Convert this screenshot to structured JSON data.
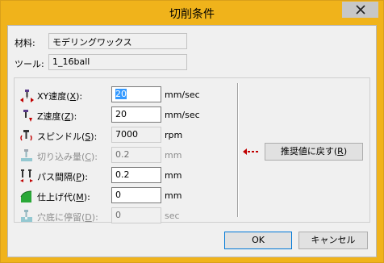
{
  "window": {
    "title": "切削条件",
    "close_glyph": "×"
  },
  "material": {
    "label": "材料:",
    "value": "モデリングワックス"
  },
  "tool": {
    "label": "ツール:",
    "value": "1_16ball"
  },
  "params": [
    {
      "label_pre": "XY速度(",
      "mnemonic": "X",
      "label_post": "):",
      "value": "20",
      "unit": "mm/sec",
      "enabled": true,
      "selected": true,
      "icon": "xy-speed-icon"
    },
    {
      "label_pre": "Z速度(",
      "mnemonic": "Z",
      "label_post": "):",
      "value": "20",
      "unit": "mm/sec",
      "enabled": true,
      "selected": false,
      "icon": "z-speed-icon"
    },
    {
      "label_pre": "スピンドル(",
      "mnemonic": "S",
      "label_post": "):",
      "value": "7000",
      "unit": "rpm",
      "enabled": true,
      "readonly": true,
      "selected": false,
      "icon": "spindle-icon"
    },
    {
      "label_pre": "切り込み量(",
      "mnemonic": "C",
      "label_post": "):",
      "value": "0.2",
      "unit": "mm",
      "enabled": false,
      "selected": false,
      "icon": "cut-depth-icon"
    },
    {
      "label_pre": "パス間隔(",
      "mnemonic": "P",
      "label_post": "):",
      "value": "0.2",
      "unit": "mm",
      "enabled": true,
      "selected": false,
      "icon": "path-interval-icon"
    },
    {
      "label_pre": "仕上げ代(",
      "mnemonic": "M",
      "label_post": "):",
      "value": "0",
      "unit": "mm",
      "enabled": true,
      "selected": false,
      "icon": "finish-allowance-icon"
    },
    {
      "label_pre": "穴底に停留(",
      "mnemonic": "D",
      "label_post": "):",
      "value": "0",
      "unit": "sec",
      "enabled": false,
      "selected": false,
      "icon": "dwell-icon"
    }
  ],
  "recommend_button": {
    "label_pre": "推奨値に戻す(",
    "mnemonic": "R",
    "label_post": ")"
  },
  "buttons": {
    "ok": "OK",
    "cancel": "キャンセル"
  },
  "colors": {
    "title_bar": "#f0b31b",
    "dialog_bg": "#f0f0f0",
    "selection": "#3399ff",
    "arrow_indicator": "#c00000"
  }
}
